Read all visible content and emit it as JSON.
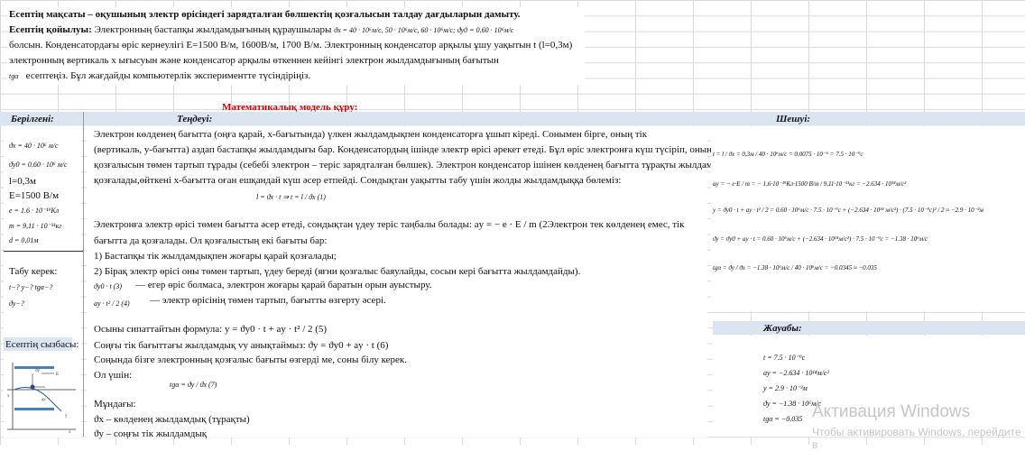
{
  "top": {
    "purpose": "Есептің мақсаты – оқушының электр өрісіндегі зарядталған бөлшектің қозғалысын талдау дағдыларын дамыту.",
    "statement_label": "Есептің қойылуы:",
    "statement_text": "Электронның бастапқы жылдамдығының құраушылары",
    "statement_values": "ϑx = 40 · 10⁶м/с,  50 · 10⁶м/с,  60 · 10⁶м/с; ϑy0 = 0.60 · 10⁶м/с",
    "line2": "болсын. Конденсатордағы өріс кернеулігі E=1500 В/м, 1600В/м, 1700 В/м. Электронның конденсатор арқылы ұшу уақытын t (l=0,3м)",
    "line3": "электронның вертикаль x ығысуын және конденсатор арқылы өткеннен кейінгі электрон жылдамдығының бағытын",
    "line4_formula": "tgα",
    "line4_text": "есептеңіз. Бұл жағдайды компьютерлік экспериментте түсіндіріңіз."
  },
  "model_title": "Математикалық модель құру:",
  "headers": {
    "given": "Берілгені:",
    "equation": "Теңдеуі:",
    "solution": "Шешуі:"
  },
  "given": {
    "vx": "ϑx = 40 · 10⁶ м/с",
    "vy0": "ϑy0 = 0.60 · 10⁶ м/с",
    "l": "l=0,3м",
    "E": "E=1500 В/м",
    "e": "e = 1.6 · 10⁻¹⁹Кл",
    "m": "m = 9,11 · 10⁻³¹кг",
    "d": "d = 0,01м",
    "find_label": "Табу керек:",
    "find1": "t−?  y−?  tgα−?",
    "find2": "ϑy−?",
    "diagram_label": "Есептің сызбасы:"
  },
  "equation": {
    "p1": "Электрон көлденең бағытта (оңға қарай, x-бағытында) үлкен  жылдамдықпен конденсаторға ұшып кіреді. Сонымен бірге, оның тік",
    "p2": "(вертикаль, y-бағытта) аздап бастапқы жылдамдығы бар. Конденсатордың  ішінде электр өрісі әрекет етеді. Бұл өріс электронға күш түсіріп, оның",
    "p3": "қозғалысын төмен тартып тұрады (себебі электрон – теріс зарядталған бөлшек). Электрон конденсатор ішінен көлденең бағытта тұрақты жылдамдықпен",
    "p4": "қозғалады,өйткені x-бағытта оған ешқандай күш әсер етпейді. Сондықтан уақытты табу үшін жолды жылдамдыққа бөлеміз:",
    "f1": "l = ϑx · t ⇒ t = l / ϑx   (1)",
    "p5": "Электронға электр өрісі төмен бағытта әсер етеді, сондықтан үдеу теріс таңбалы  болады: ay = − e · E / m   (2Электрон тек көлденең емес,  тік",
    "p6": "бағытта да қозғалады. Ол қозғалыстың екі  бағыты бар:",
    "p7": "1) Бастапқы тік жылдамдықпен жоғары қарай қозғалады;",
    "p8": "2) Бірақ электр өрісі оны төмен тартып, үдеу береді (яғни қозғалыс баяулайды, сосын кері бағытта жылдамдайды).",
    "f3": "ϑy0 · t (3)",
    "p9": "— егер өріс болмаса, электрон жоғары қарай баратын орын ауыстыру.",
    "f4": "ay · t² / 2   (4)",
    "p10": "— электр өрісінің төмен тартып, бағытты өзгерту әсері.",
    "p11": "Осыны сипаттайтын формула: y = ϑy0 · t + ay · t² / 2   (5)",
    "p12": "Соңғы тік бағыттағы жылдамдық vy анықтаймыз: ϑy = ϑy0 + ay · t  (6)",
    "p13": "Соңында бізге электронның қозғалыс бағыты өзгерді ме, соны білу керек.",
    "p14": "Ол үшін:",
    "f7": "tgα = ϑy / ϑx   (7)",
    "p15": "Мұндағы:",
    "p16": "ϑx  – көлденең жылдамдық (тұрақты)",
    "p17": "ϑy  – соңғы тік жылдамдық"
  },
  "solution": {
    "s1": "t = l / ϑx = 0,3м / 40 · 10⁶м/с = 0.0075 · 10⁻⁶ = 7.5 · 10⁻⁹с",
    "s2": "ay = − e·E / m = − 1,6·10⁻¹⁹Кл·1500 В/м / 9,11·10⁻³¹кг = −2.634 · 10¹⁴м/с²",
    "s3": "y = ϑy0 · t + ay · t² / 2 = 0.60 · 10⁶м/с · 7.5 · 10⁻⁹с + (−2.634 · 10¹⁴ м/с²) · (7.5 · 10⁻⁹с)² / 2 ≈ −2.9 · 10⁻³м",
    "s4": "ϑy = ϑy0 + ay · t = 0.60 · 10⁶м/с + (−2.634 · 10¹⁴м/с²) · 7.5 · 10⁻⁹с = −1.38 · 10⁶м/с",
    "s5": "tgα = ϑy / ϑx = −1.38 · 10⁶м/с / 40 · 10⁶м/с = −0.0345 ≈ −0.035"
  },
  "answer": {
    "label": "Жауабы:",
    "a1": "t = 7.5 · 10⁻⁹с",
    "a2": "ay = −2.634 · 10¹⁴м/с²",
    "a3": "y = 2.9 · 10⁻³м",
    "a4": "ϑy = −1.38 · 10⁶м/с",
    "a5": "tgα = −0.035"
  },
  "watermark": {
    "title": "Активация Windows",
    "subtitle": "Чтобы активировать Windows, перейдите в"
  },
  "colors": {
    "band": "#dbe5f1",
    "red": "#e00000",
    "grid": "#d9d9d9"
  }
}
